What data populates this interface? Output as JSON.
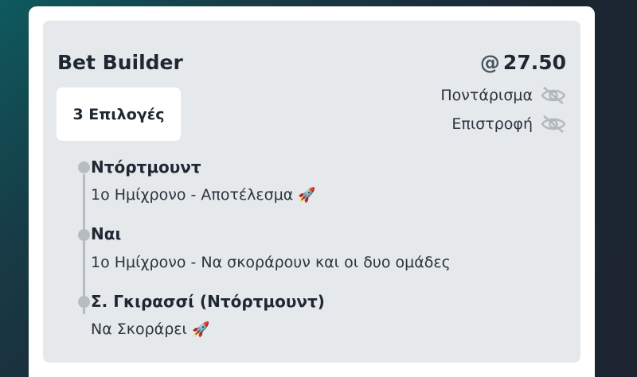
{
  "card": {
    "title": "Bet Builder",
    "odds_prefix": "@",
    "odds": "27.50",
    "selections_label": "3 Επιλογές",
    "stake_label": "Ποντάρισμα",
    "return_label": "Επιστροφή"
  },
  "legs": [
    {
      "name": "Ντόρτμουντ",
      "market": "1ο Ημίχρονο - Αποτέλεσμα",
      "icon": "rocket-icon"
    },
    {
      "name": "Ναι",
      "market": "1ο Ημίχρονο - Να σκοράρουν και οι δυο ομάδες",
      "icon": ""
    },
    {
      "name": "Σ. Γκιρασσί (Ντόρτμουντ)",
      "market": "Να Σκοράρει",
      "icon": "rocket-icon"
    }
  ]
}
